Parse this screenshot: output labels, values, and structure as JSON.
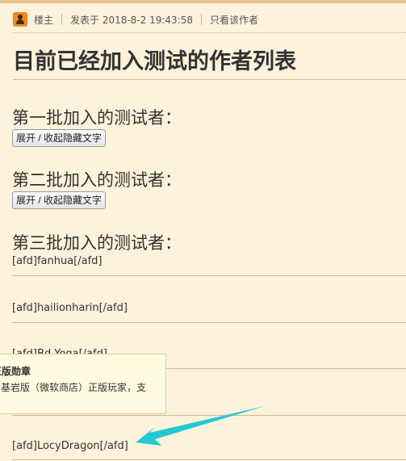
{
  "post_meta": {
    "author_role": "楼主",
    "posted_at": "发表于 2018-8-2 19:43:58",
    "only_author_link": "只看该作者"
  },
  "title": "目前已经加入测试的作者列表",
  "groups": [
    {
      "heading": "第一批加入的测试者：",
      "toggle_label": "展开 / 收起隐藏文字"
    },
    {
      "heading": "第二批加入的测试者：",
      "toggle_label": "展开 / 收起隐藏文字"
    },
    {
      "heading": "第三批加入的测试者："
    }
  ],
  "afd_items": [
    "[afd]fanhua[/afd]",
    "[afd]hailionharin[/afd]",
    "[afd]Bd Yoga[/afd]",
    "[afd]LocyDragon[/afd]"
  ],
  "tooltip": {
    "title": "正版勋章",
    "description": "的基岩版（微软商店）正版玩家，支"
  },
  "colors": {
    "page_background": "#fdf2dc",
    "host_icon": "#f08a1c",
    "annotation_arrow": "#23c9d2"
  },
  "icons": [
    "host-user-icon",
    "annotation-arrow"
  ]
}
